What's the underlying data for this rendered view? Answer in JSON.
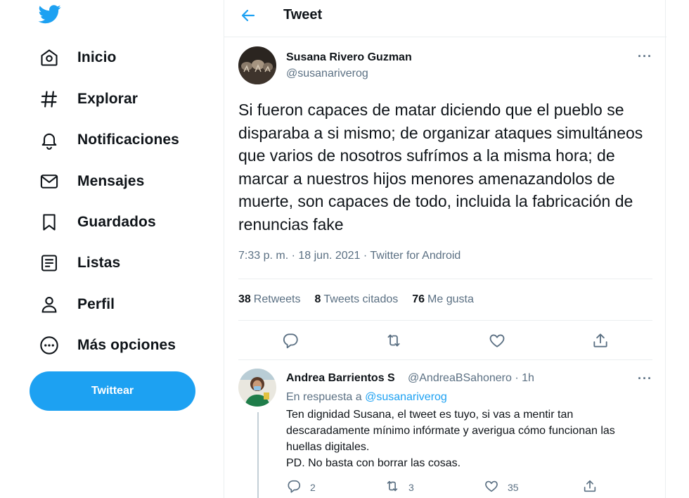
{
  "sidebar": {
    "logo": "twitter-bird-icon",
    "items": [
      {
        "label": "Inicio",
        "icon": "home-icon"
      },
      {
        "label": "Explorar",
        "icon": "hashtag-icon"
      },
      {
        "label": "Notificaciones",
        "icon": "bell-icon"
      },
      {
        "label": "Mensajes",
        "icon": "envelope-icon"
      },
      {
        "label": "Guardados",
        "icon": "bookmark-icon"
      },
      {
        "label": "Listas",
        "icon": "list-icon"
      },
      {
        "label": "Perfil",
        "icon": "person-icon"
      },
      {
        "label": "Más opciones",
        "icon": "more-circle-icon"
      }
    ],
    "tweet_button": "Twittear"
  },
  "header": {
    "title": "Tweet"
  },
  "tweet": {
    "author_name": "Susana Rivero Guzman",
    "author_handle": "@susanariverog",
    "text": "Si fueron capaces de matar diciendo que el pueblo se disparaba a si mismo; de organizar ataques simultáneos que varios de nosotros sufrímos a la misma hora; de marcar a nuestros hijos menores amenazandolos de muerte, son capaces de todo, incluida la fabricación de renuncias fake",
    "meta": "7:33 p. m. · 18 jun. 2021 · Twitter for Android",
    "stats": {
      "retweets_count": "38",
      "retweets_label": "Retweets",
      "quotes_count": "8",
      "quotes_label": "Tweets citados",
      "likes_count": "76",
      "likes_label": "Me gusta"
    },
    "more": "···"
  },
  "reply": {
    "author_name": "Andrea Barrientos S",
    "author_handle": "@AndreaBSahonero · 1h",
    "replying_prefix": "En respuesta a",
    "replying_mention": "@susanariverog",
    "line1": "Ten dignidad Susana, el tweet es tuyo, si vas a mentir tan",
    "line2": "descaradamente mínimo infórmate y averigua cómo funcionan las",
    "line3": "huellas digitales.",
    "line4": "PD. No basta con borrar las cosas.",
    "replies": "2",
    "retweets": "3",
    "likes": "35",
    "more": "···"
  },
  "colors": {
    "accent": "#1da1f2",
    "secondary_text": "#5b7083",
    "border": "#ebeef0"
  }
}
